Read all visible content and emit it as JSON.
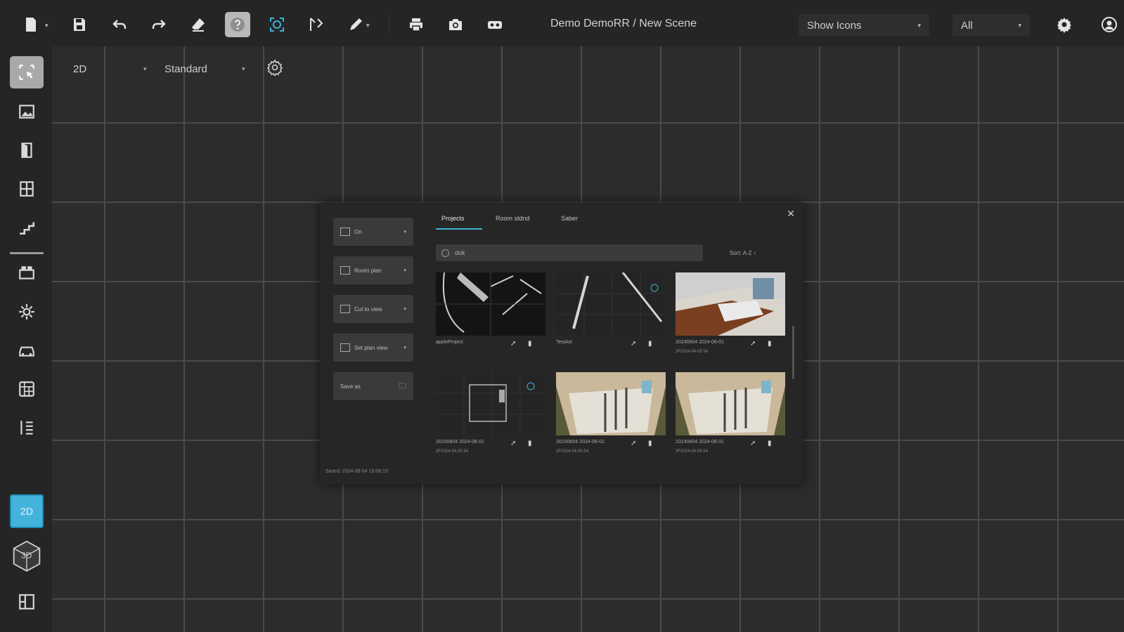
{
  "toolbar": {
    "scene_title": "Demo DemoRR / New Scene",
    "show_select": "Show Icons",
    "filter_select": "All"
  },
  "view": {
    "mode": "2D",
    "style": "Standard"
  },
  "sidebar": {
    "mode_2d": "2D",
    "mode_3d": "3D"
  },
  "dialog": {
    "side_buttons": [
      "On",
      "Room plan",
      "Cut to view",
      "Set plan view",
      "Save as"
    ],
    "footer": "Saved: 2024-06-04 15:06:19",
    "tabs": [
      "Projects",
      "Room stdnd",
      "Saber"
    ],
    "search_value": "dok",
    "sort_label": "Sort: A-Z ↑",
    "cards": [
      {
        "title": "appleProject",
        "subtitle": ""
      },
      {
        "title": "TestAct",
        "subtitle": ""
      },
      {
        "title": "20240604 2024-06-01",
        "subtitle": "3F2024-04-05 54"
      },
      {
        "title": "20240604 2024-06-01",
        "subtitle": "3F2024-04-05 54"
      },
      {
        "title": "20240604 2024-06-01",
        "subtitle": "3F2024-04-05 54"
      },
      {
        "title": "20240604 2024-06-01",
        "subtitle": "3F2024-04-05 54"
      }
    ]
  },
  "colors": {
    "accent": "#3fb2d9",
    "background": "#2b2b2b",
    "panel": "#252525"
  }
}
